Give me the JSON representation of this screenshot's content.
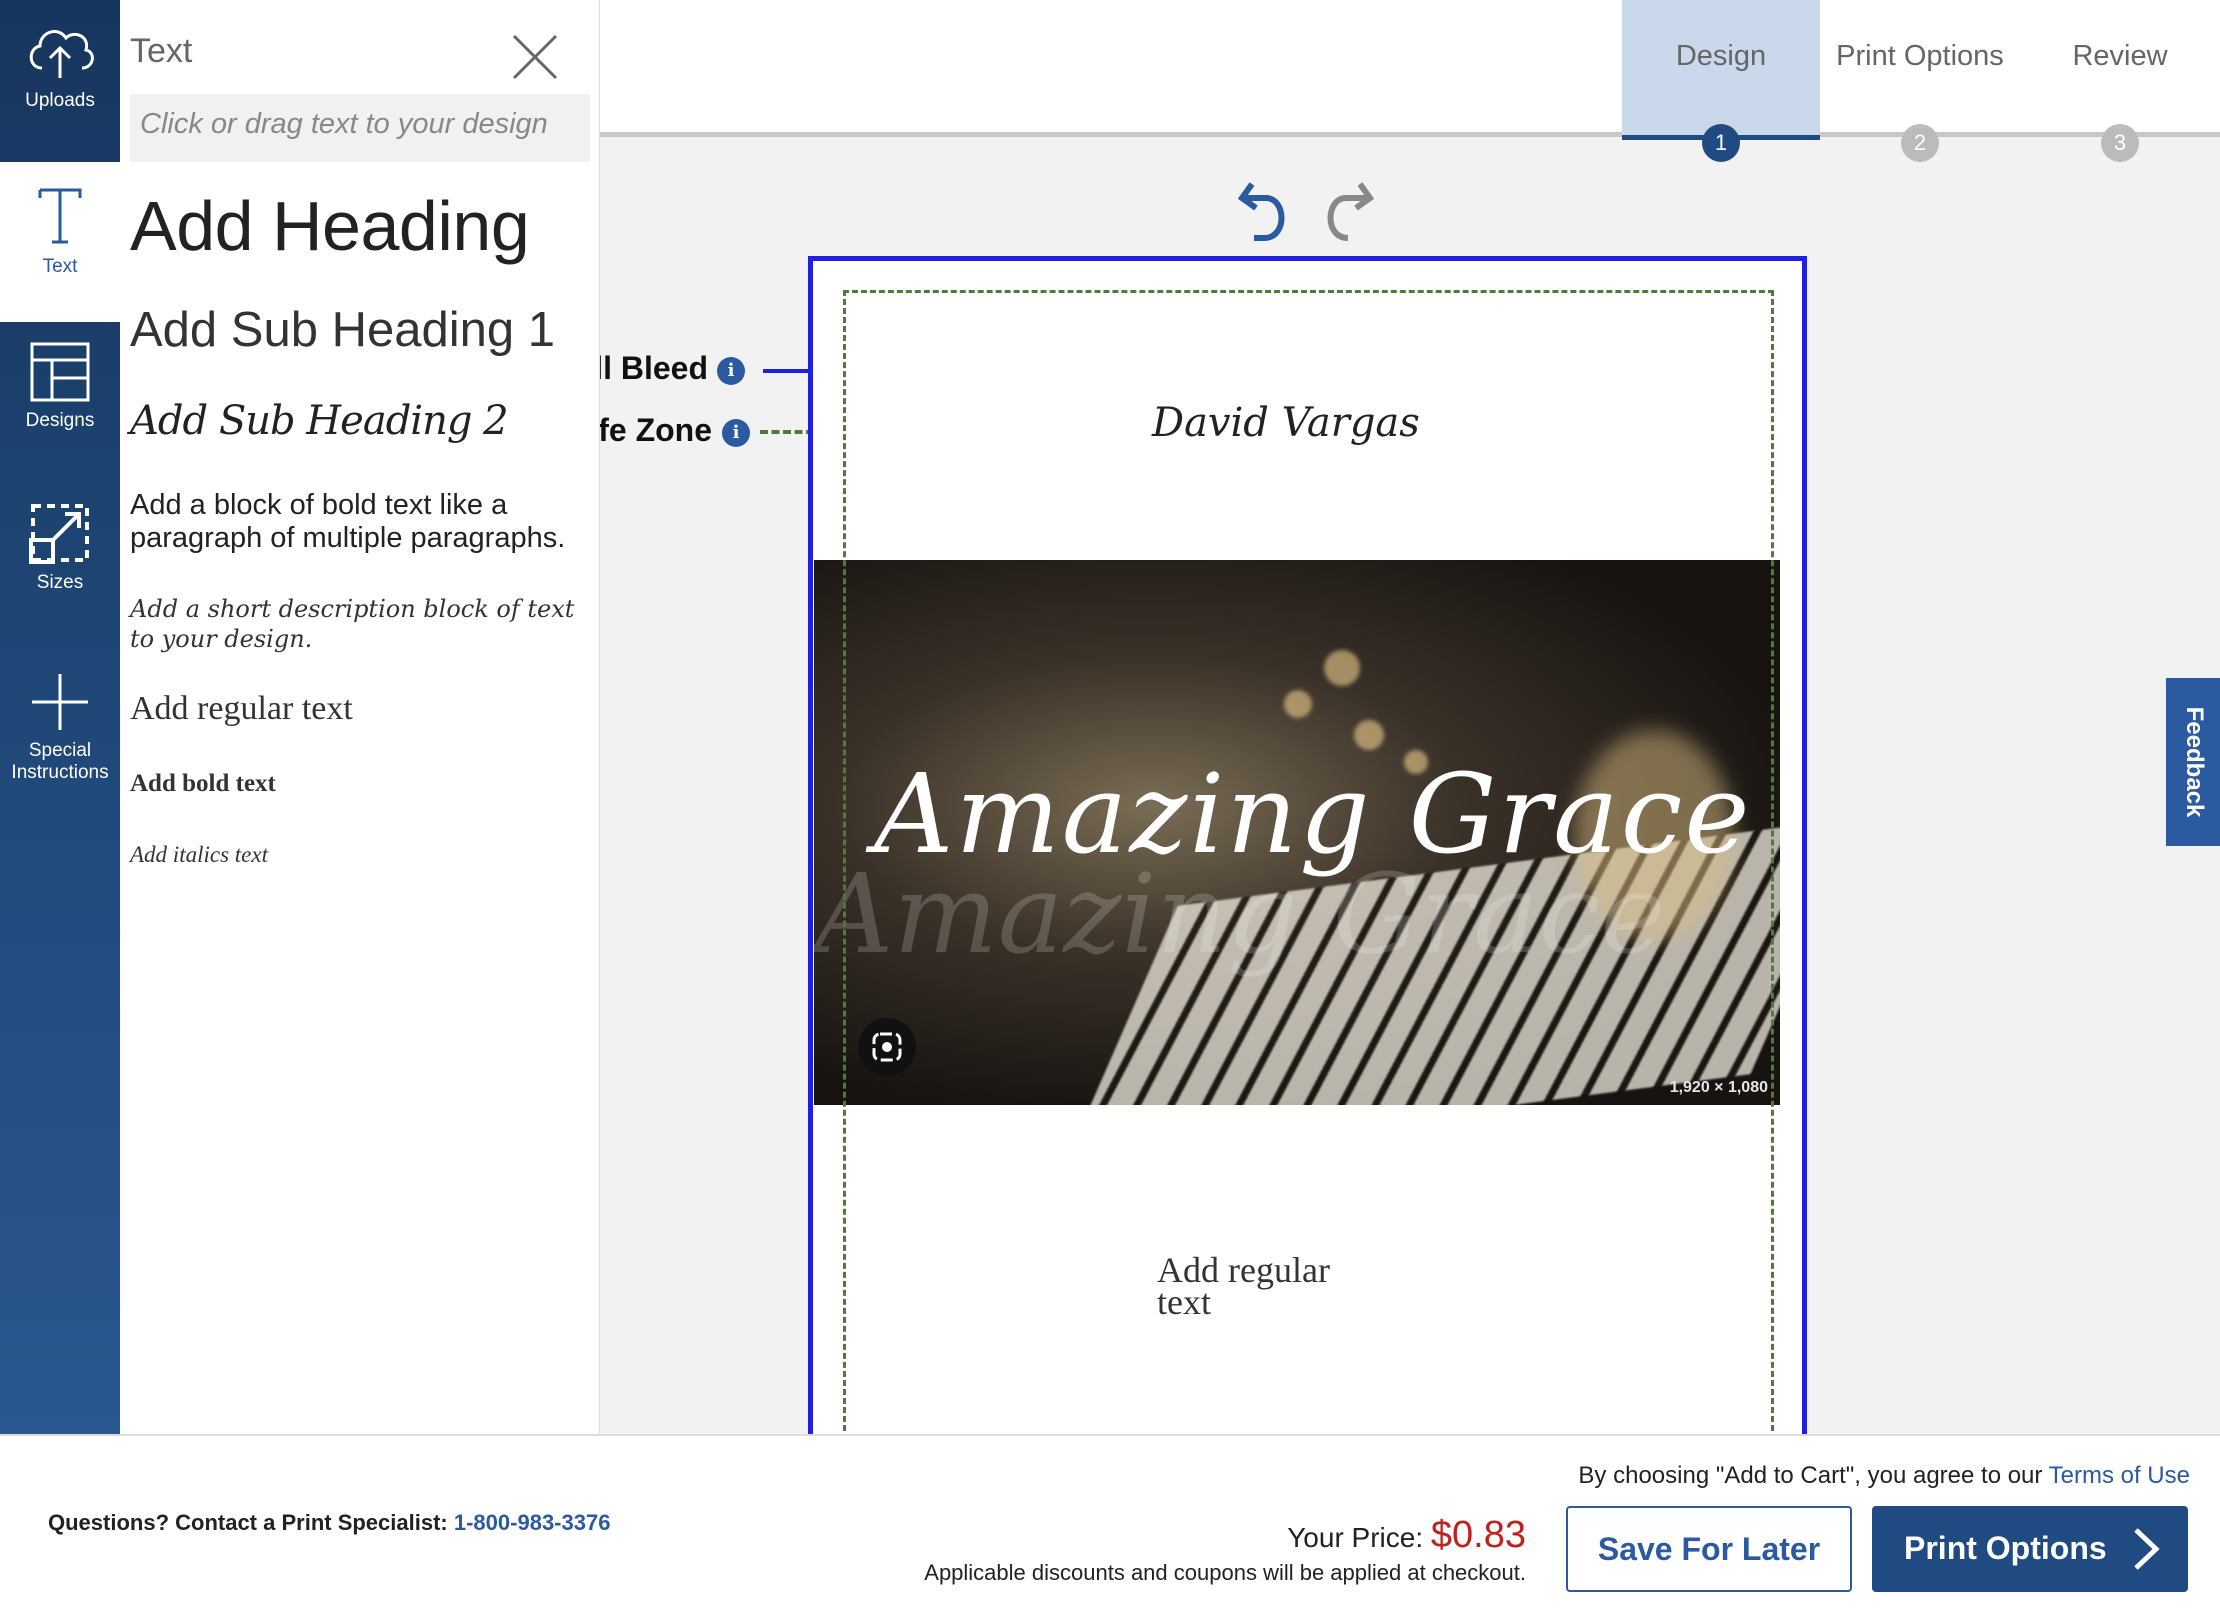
{
  "sidebar": {
    "items": [
      {
        "label": "Uploads",
        "icon": "cloud-upload-icon"
      },
      {
        "label": "Text",
        "icon": "text-icon"
      },
      {
        "label": "Designs",
        "icon": "layout-icon"
      },
      {
        "label": "Sizes",
        "icon": "resize-icon"
      },
      {
        "label": "Special\nInstructions",
        "icon": "plus-icon"
      }
    ]
  },
  "text_panel": {
    "title": "Text",
    "hint": "Click or drag text to your design",
    "options": {
      "heading": "Add Heading",
      "sub_heading_1": "Add Sub Heading 1",
      "sub_heading_2": "Add Sub Heading 2",
      "block": "Add a block of bold text like a paragraph of multiple paragraphs.",
      "description": "Add a short description block of text to your design.",
      "regular": "Add regular text",
      "bold": "Add bold text",
      "italic": "Add italics text"
    }
  },
  "steps": [
    {
      "label": "Design",
      "num": "1"
    },
    {
      "label": "Print Options",
      "num": "2"
    },
    {
      "label": "Review",
      "num": "3"
    }
  ],
  "guides": {
    "bleed": "Full Bleed",
    "safe": "Safe Zone",
    "info": "i"
  },
  "canvas": {
    "name": "David Vargas",
    "photo_title": "Amazing Grace",
    "photo_dimensions": "1,920 × 1,080",
    "regular_text": "Add regular text"
  },
  "feedback": "Feedback",
  "footer": {
    "contact_label": "Questions? Contact a Print Specialist:",
    "phone": "1-800-983-3376",
    "terms_prefix": "By choosing \"Add to Cart\", you agree to our",
    "terms_link": "Terms of Use",
    "price_label": "Your Price:",
    "price": "$0.83",
    "discount_note": "Applicable discounts and coupons will be applied at checkout.",
    "save_label": "Save For Later",
    "print_label": "Print Options"
  },
  "colors": {
    "rail": "#1f4878",
    "accent": "#2b5aa0",
    "bleed": "#2020e0",
    "safe": "#4e7a3a",
    "price": "#c0201e"
  }
}
